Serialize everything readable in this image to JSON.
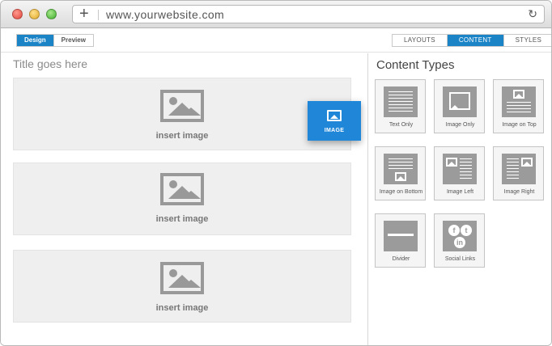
{
  "browser": {
    "url": "www.yourwebsite.com",
    "new_tab_glyph": "+",
    "reload_glyph": "↻"
  },
  "mode_tabs": [
    {
      "label": "Design",
      "active": true
    },
    {
      "label": "Preview",
      "active": false
    }
  ],
  "panel_tabs": [
    {
      "label": "LAYOUTS",
      "active": false
    },
    {
      "label": "CONTENT",
      "active": true
    },
    {
      "label": "STYLES",
      "active": false
    }
  ],
  "canvas": {
    "title": "Title goes here",
    "blocks": [
      {
        "label": "insert image"
      },
      {
        "label": "insert image"
      },
      {
        "label": "insert image"
      }
    ]
  },
  "drag_item": {
    "label": "IMAGE",
    "icon": "image-icon"
  },
  "content_panel": {
    "title": "Content Types",
    "items": [
      {
        "label": "Text Only",
        "icon": "text-only-icon"
      },
      {
        "label": "Image Only",
        "icon": "image-only-icon"
      },
      {
        "label": "Image on Top",
        "icon": "image-on-top-icon"
      },
      {
        "label": "Image on Bottom",
        "icon": "image-on-bottom-icon"
      },
      {
        "label": "Image Left",
        "icon": "image-left-icon"
      },
      {
        "label": "Image Right",
        "icon": "image-right-icon"
      },
      {
        "label": "Divider",
        "icon": "divider-icon"
      },
      {
        "label": "Social Links",
        "icon": "social-links-icon"
      }
    ]
  },
  "colors": {
    "accent": "#1b84c7",
    "drag": "#1f86d8"
  }
}
